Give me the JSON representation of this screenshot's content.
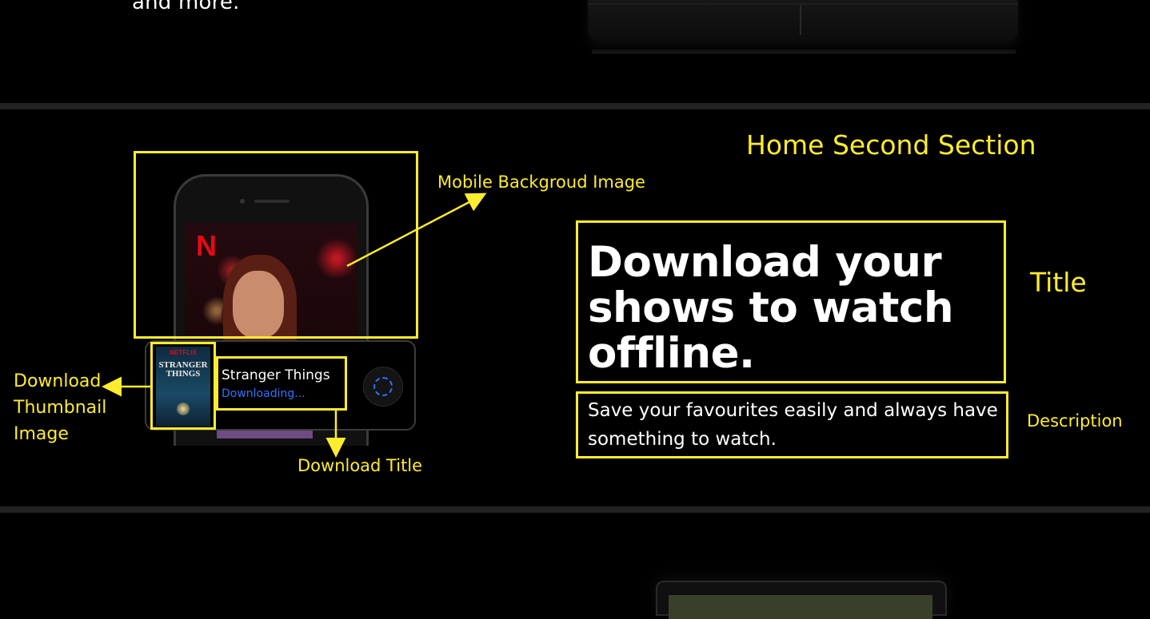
{
  "section_top": {
    "text": "and more."
  },
  "hero": {
    "title": "Download your shows to watch offline.",
    "description": "Save your favourites easily and always have something to watch."
  },
  "download_card": {
    "thumbnail_brand": "NETFLIX",
    "thumbnail_title": "STRANGER THINGS",
    "title": "Stranger Things",
    "status": "Downloading..."
  },
  "annotations": {
    "section": "Home Second Section",
    "mobile_bg": "Mobile Backgroud Image",
    "title": "Title",
    "description": "Description",
    "thumbnail_line1": "Download",
    "thumbnail_line2": "Thumbnail",
    "thumbnail_line3": "Image",
    "download_title": "Download Title"
  },
  "phone_logo": "N",
  "colors": {
    "background": "#000000",
    "annotation": "#ffec2e",
    "accent_blue": "#2f73ff",
    "divider": "#222222",
    "netflix_red": "#e50914"
  }
}
